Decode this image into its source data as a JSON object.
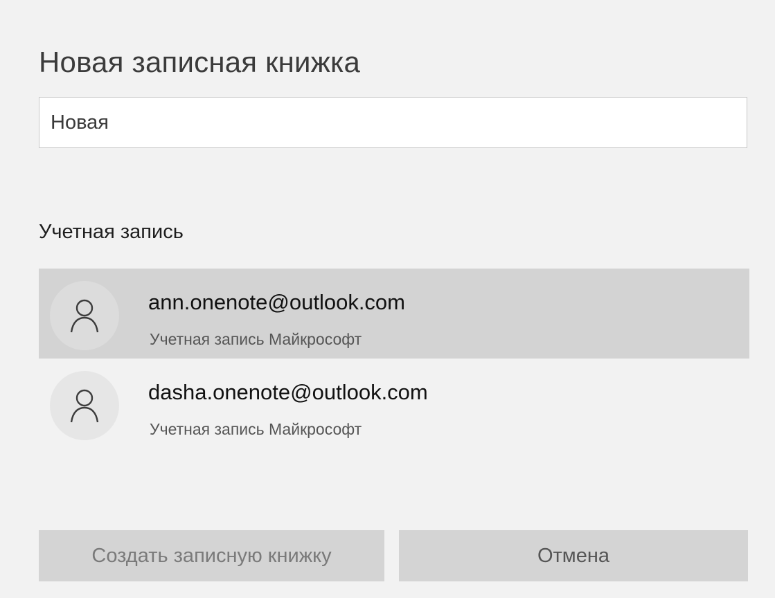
{
  "dialog": {
    "title": "Новая записная книжка",
    "name_input": {
      "value": "Новая",
      "placeholder": ""
    },
    "account_section_label": "Учетная запись",
    "accounts": [
      {
        "email": "ann.onenote@outlook.com",
        "type": "Учетная запись Майкрософт",
        "icon": "person-icon",
        "selected": true
      },
      {
        "email": "dasha.onenote@outlook.com",
        "type": "Учетная запись Майкрософт",
        "icon": "person-icon",
        "selected": false
      }
    ],
    "buttons": {
      "create_label": "Создать записную книжку",
      "cancel_label": "Отмена"
    }
  },
  "colors": {
    "dialog_background": "#f2f2f2",
    "selected_row": "#d3d3d3",
    "button_background": "#d4d4d4",
    "avatar_background": "#e6e6e6"
  }
}
